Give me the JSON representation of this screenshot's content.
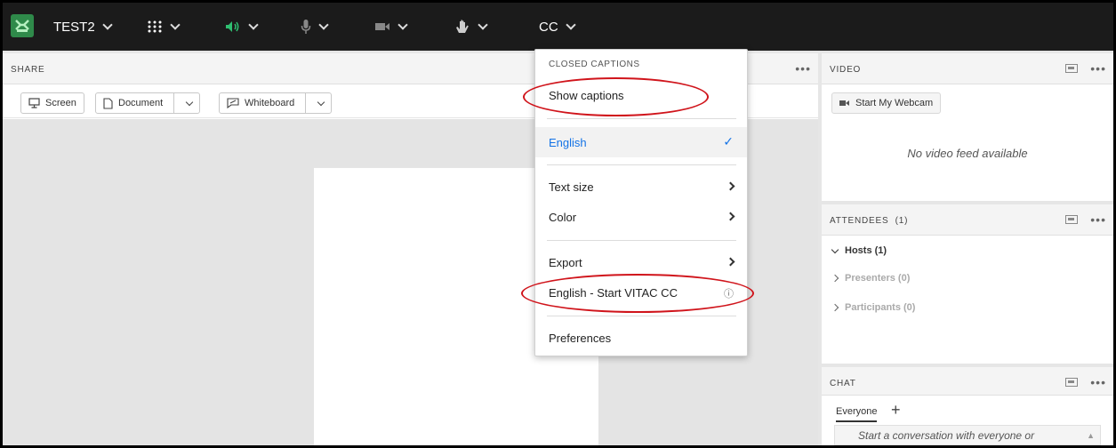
{
  "topbar": {
    "meeting_name": "TEST2",
    "cc_label": "CC"
  },
  "share": {
    "title": "SHARE",
    "screen_label": "Screen",
    "document_label": "Document",
    "whiteboard_label": "Whiteboard"
  },
  "video": {
    "title": "VIDEO",
    "start_webcam": "Start My Webcam",
    "no_feed": "No video feed available"
  },
  "attendees": {
    "title": "ATTENDEES  (1)",
    "hosts": "Hosts (1)",
    "presenters": "Presenters (0)",
    "participants": "Participants (0)"
  },
  "chat": {
    "title": "CHAT",
    "tab_everyone": "Everyone",
    "placeholder": "Start a conversation with everyone or"
  },
  "cc_menu": {
    "header": "CLOSED CAPTIONS",
    "show_captions": "Show captions",
    "english": "English",
    "check": "✓",
    "text_size": "Text size",
    "color": "Color",
    "export": "Export",
    "vitac": "English - Start VITAC CC",
    "info": "ⓘ",
    "preferences": "Preferences"
  },
  "colors": {
    "topbar_bg": "#1b1b1b",
    "accent_blue": "#1473e6",
    "mic_green": "#2fbf71",
    "annotation_red": "#d0141b"
  }
}
